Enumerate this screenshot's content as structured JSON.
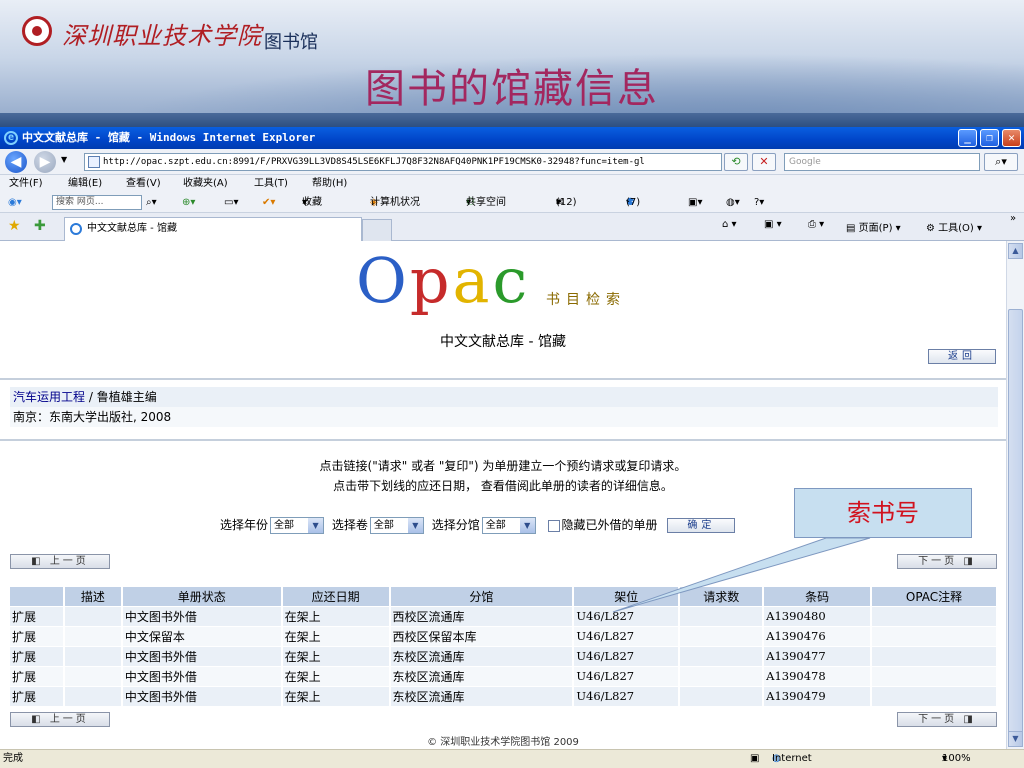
{
  "slide": {
    "school_name": "深圳职业技术学院",
    "library": "图书馆",
    "title": "图书的馆藏信息"
  },
  "window": {
    "title": "中文文献总库 - 馆藏 - Windows Internet Explorer",
    "minimize": "_",
    "restore": "❐",
    "close": "✕"
  },
  "address": {
    "url": "http://opac.szpt.edu.cn:8991/F/PRXVG39LL3VD8S45LSE6KFLJ7Q8F32N8AFQ40PNK1PF19CMSK0-32948?func=item-gl",
    "search_placeholder": "Google"
  },
  "menu": [
    "文件(F)",
    "编辑(E)",
    "查看(V)",
    "收藏夹(A)",
    "工具(T)",
    "帮助(H)"
  ],
  "links": {
    "search_box": "搜索 网页...",
    "favorites": "收藏",
    "computer_status": "计算机状况",
    "shared_space": "共享空间",
    "mail_count": "(12)",
    "contacts": "(7)"
  },
  "tabbar": {
    "tab_label": "中文文献总库 - 馆藏",
    "page": "页面(P)",
    "tools": "工具(O)"
  },
  "page": {
    "logo_subtitle": "书目检索",
    "heading": "中文文献总库 - 馆藏",
    "return_btn": "返回",
    "bib_title_link": "汽车运用工程",
    "bib_author": " / 鲁植雄主编",
    "bib_publisher": "南京：东南大学出版社, 2008",
    "info1": "点击链接(\"请求\" 或者 \"复印\") 为单册建立一个预约请求或复印请求。",
    "info2": "点击带下划线的应还日期，   查看借阅此单册的读者的详细信息。",
    "filter_year": "选择年份",
    "filter_vol": "选择卷",
    "filter_branch": "选择分馆",
    "all_opt": "全部",
    "hide_label": "隐藏已外借的单册",
    "ok_btn": "确定",
    "prev": "上一页",
    "next": "下一页",
    "footer": "© 深圳职业技术学院图书馆 2009"
  },
  "table": {
    "headers": [
      "",
      "描述",
      "单册状态",
      "应还日期",
      "分馆",
      "架位",
      "请求数",
      "条码",
      "OPAC注释"
    ],
    "rows": [
      [
        "扩展",
        "",
        "中文图书外借",
        "在架上",
        "西校区流通库",
        "U46/L827",
        "",
        "A1390480",
        ""
      ],
      [
        "扩展",
        "",
        "中文保留本",
        "在架上",
        "西校区保留本库",
        "U46/L827",
        "",
        "A1390476",
        ""
      ],
      [
        "扩展",
        "",
        "中文图书外借",
        "在架上",
        "东校区流通库",
        "U46/L827",
        "",
        "A1390477",
        ""
      ],
      [
        "扩展",
        "",
        "中文图书外借",
        "在架上",
        "东校区流通库",
        "U46/L827",
        "",
        "A1390478",
        ""
      ],
      [
        "扩展",
        "",
        "中文图书外借",
        "在架上",
        "东校区流通库",
        "U46/L827",
        "",
        "A1390479",
        ""
      ]
    ]
  },
  "status": {
    "left": "完成",
    "zone": "Internet",
    "zoom": "100%"
  },
  "callout": "索书号",
  "colors": {
    "title": "#a3275f",
    "callout_text": "#d1121e",
    "callout_bg": "#c7dff0",
    "header_bg": "#c0d0e6",
    "ie_blue": "#0044c8"
  }
}
